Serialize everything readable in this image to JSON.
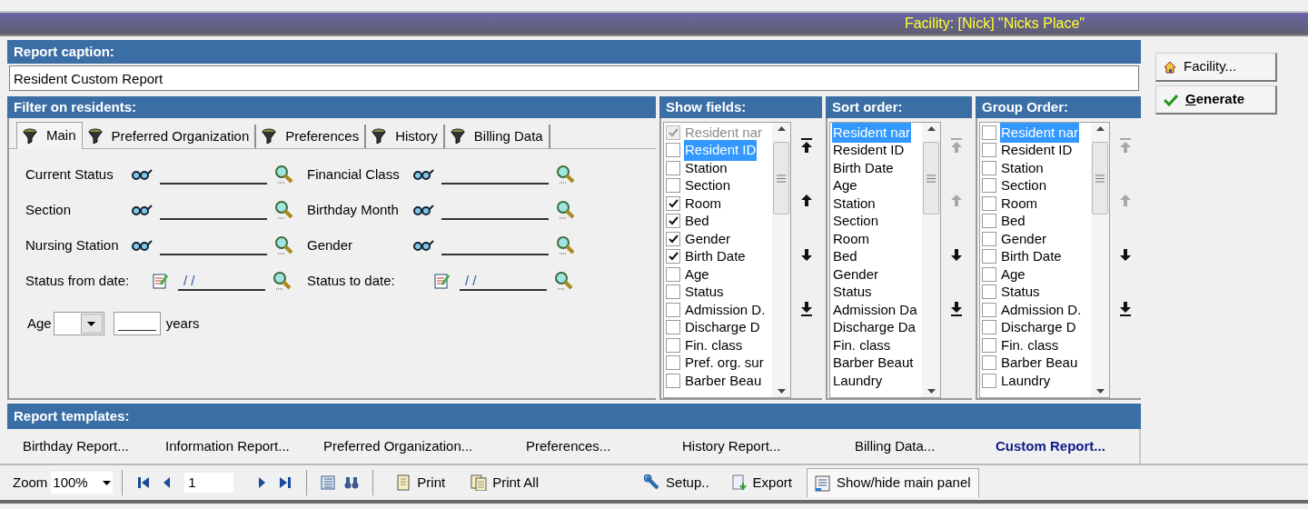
{
  "facility_bar": {
    "text": "Facility: [Nick] \"Nicks Place\""
  },
  "report_caption": {
    "label": "Report caption:",
    "value": "Resident Custom Report"
  },
  "filter": {
    "label": "Filter on residents:",
    "tabs": [
      {
        "label": "Main",
        "selected": true
      },
      {
        "label": "Preferred Organization",
        "selected": false
      },
      {
        "label": "Preferences",
        "selected": false
      },
      {
        "label": "History",
        "selected": false
      },
      {
        "label": "Billing Data",
        "selected": false
      }
    ],
    "fields": [
      {
        "kind": "lookup",
        "label": "Current Status"
      },
      {
        "kind": "lookup",
        "label": "Financial Class"
      },
      {
        "kind": "lookup",
        "label": "Section"
      },
      {
        "kind": "lookup",
        "label": "Birthday Month"
      },
      {
        "kind": "lookup",
        "label": "Nursing Station"
      },
      {
        "kind": "lookup",
        "label": "Gender"
      },
      {
        "kind": "date",
        "label": "Status from date:",
        "value": "/ /"
      },
      {
        "kind": "date",
        "label": "Status to date:",
        "value": "/ /"
      }
    ],
    "age": {
      "label": "Age",
      "unit": "years"
    }
  },
  "show_fields": {
    "label": "Show fields:",
    "items": [
      {
        "text": "Resident nar",
        "checked": true,
        "disabled": true,
        "selected": false
      },
      {
        "text": "Resident ID",
        "checked": false,
        "disabled": false,
        "selected": true
      },
      {
        "text": "Station",
        "checked": false,
        "disabled": false,
        "selected": false
      },
      {
        "text": "Section",
        "checked": false,
        "disabled": false,
        "selected": false
      },
      {
        "text": "Room",
        "checked": true,
        "disabled": false,
        "selected": false
      },
      {
        "text": "Bed",
        "checked": true,
        "disabled": false,
        "selected": false
      },
      {
        "text": "Gender",
        "checked": true,
        "disabled": false,
        "selected": false
      },
      {
        "text": "Birth Date",
        "checked": true,
        "disabled": false,
        "selected": false
      },
      {
        "text": "Age",
        "checked": false,
        "disabled": false,
        "selected": false
      },
      {
        "text": "Status",
        "checked": false,
        "disabled": false,
        "selected": false
      },
      {
        "text": "Admission D.",
        "checked": false,
        "disabled": false,
        "selected": false
      },
      {
        "text": "Discharge D",
        "checked": false,
        "disabled": false,
        "selected": false
      },
      {
        "text": "Fin. class",
        "checked": false,
        "disabled": false,
        "selected": false
      },
      {
        "text": "Pref. org. sur",
        "checked": false,
        "disabled": false,
        "selected": false
      },
      {
        "text": "Barber Beau",
        "checked": false,
        "disabled": false,
        "selected": false
      }
    ],
    "move_buttons": [
      {
        "kind": "top",
        "disabled": false
      },
      {
        "kind": "up",
        "disabled": false
      },
      {
        "kind": "down",
        "disabled": false
      },
      {
        "kind": "bottom",
        "disabled": false
      }
    ]
  },
  "sort_order": {
    "label": "Sort order:",
    "items": [
      {
        "text": "Resident nar",
        "selected": true
      },
      {
        "text": "Resident ID",
        "selected": false
      },
      {
        "text": "Birth Date",
        "selected": false
      },
      {
        "text": "Age",
        "selected": false
      },
      {
        "text": "Station",
        "selected": false
      },
      {
        "text": "Section",
        "selected": false
      },
      {
        "text": "Room",
        "selected": false
      },
      {
        "text": "Bed",
        "selected": false
      },
      {
        "text": "Gender",
        "selected": false
      },
      {
        "text": "Status",
        "selected": false
      },
      {
        "text": "Admission Da",
        "selected": false
      },
      {
        "text": "Discharge Da",
        "selected": false
      },
      {
        "text": "Fin. class",
        "selected": false
      },
      {
        "text": "Barber Beaut",
        "selected": false
      },
      {
        "text": "Laundry",
        "selected": false
      }
    ],
    "move_buttons": [
      {
        "kind": "top",
        "disabled": true
      },
      {
        "kind": "up",
        "disabled": true
      },
      {
        "kind": "down",
        "disabled": false
      },
      {
        "kind": "bottom",
        "disabled": false
      }
    ]
  },
  "group_order": {
    "label": "Group Order:",
    "items": [
      {
        "text": "Resident nar",
        "checked": false,
        "selected": true
      },
      {
        "text": "Resident ID",
        "checked": false,
        "selected": false
      },
      {
        "text": "Station",
        "checked": false,
        "selected": false
      },
      {
        "text": "Section",
        "checked": false,
        "selected": false
      },
      {
        "text": "Room",
        "checked": false,
        "selected": false
      },
      {
        "text": "Bed",
        "checked": false,
        "selected": false
      },
      {
        "text": "Gender",
        "checked": false,
        "selected": false
      },
      {
        "text": "Birth Date",
        "checked": false,
        "selected": false
      },
      {
        "text": "Age",
        "checked": false,
        "selected": false
      },
      {
        "text": "Status",
        "checked": false,
        "selected": false
      },
      {
        "text": "Admission D.",
        "checked": false,
        "selected": false
      },
      {
        "text": "Discharge D",
        "checked": false,
        "selected": false
      },
      {
        "text": "Fin. class",
        "checked": false,
        "selected": false
      },
      {
        "text": "Barber Beau",
        "checked": false,
        "selected": false
      },
      {
        "text": "Laundry",
        "checked": false,
        "selected": false
      }
    ],
    "move_buttons": [
      {
        "kind": "top",
        "disabled": true
      },
      {
        "kind": "up",
        "disabled": true
      },
      {
        "kind": "down",
        "disabled": false
      },
      {
        "kind": "bottom",
        "disabled": false
      }
    ]
  },
  "side_buttons": [
    {
      "kind": "facility",
      "label": "Facility..."
    },
    {
      "kind": "generate",
      "label": "Generate"
    }
  ],
  "templates": {
    "label": "Report templates:",
    "items": [
      {
        "text": "Birthday Report...",
        "selected": false
      },
      {
        "text": "Information Report...",
        "selected": false
      },
      {
        "text": "Preferred Organization...",
        "selected": false
      },
      {
        "text": "Preferences...",
        "selected": false
      },
      {
        "text": "History Report...",
        "selected": false
      },
      {
        "text": "Billing Data...",
        "selected": false
      },
      {
        "text": "Custom Report...",
        "selected": true
      }
    ]
  },
  "toolbar": {
    "zoom_label": "Zoom",
    "zoom_value": "100%",
    "page": "1",
    "buttons": [
      {
        "kind": "print",
        "label": "Print",
        "pressed": false
      },
      {
        "kind": "print_all",
        "label": "Print All",
        "pressed": false
      },
      {
        "kind": "setup",
        "label": "Setup..",
        "pressed": false
      },
      {
        "kind": "export",
        "label": "Export",
        "pressed": false
      },
      {
        "kind": "panel",
        "label": "Show/hide main panel",
        "pressed": true
      }
    ]
  }
}
